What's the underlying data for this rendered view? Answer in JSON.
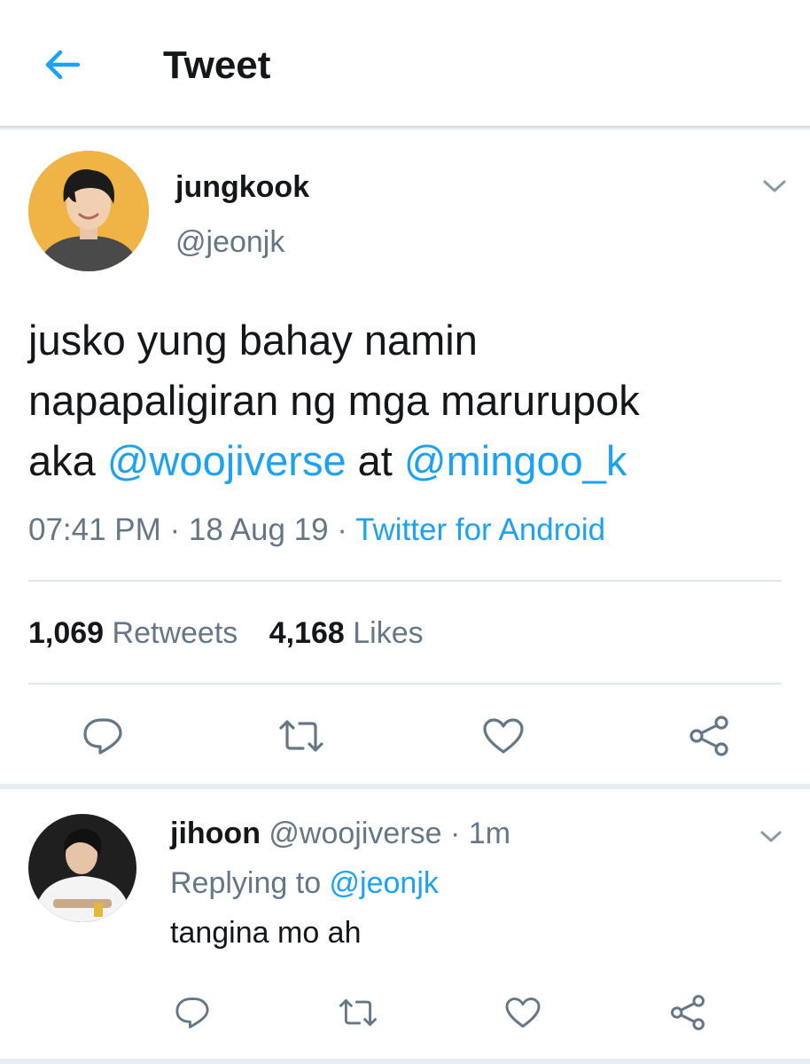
{
  "header": {
    "back_icon": "arrow-left-icon",
    "title": "Tweet",
    "accent_color": "#1da1f2"
  },
  "tweet": {
    "author_name": "jungkook",
    "author_handle": "@jeonjk",
    "menu_icon": "chevron-down-icon",
    "text_lines": [
      "jusko yung bahay namin",
      "napapaligiran ng mga marurupok"
    ],
    "text_prefix": "aka ",
    "mention_1": "@woojiverse",
    "text_middle": " at ",
    "mention_2": "@mingoo_k",
    "time": "07:41 PM",
    "sep_1": " · ",
    "date": "18 Aug 19",
    "sep_2": " · ",
    "source": "Twitter for Android",
    "retweets_count": "1,069",
    "retweets_label": " Retweets",
    "likes_count": "4,168",
    "likes_label": " Likes",
    "actions": [
      "reply-icon",
      "retweet-icon",
      "like-icon",
      "share-icon"
    ]
  },
  "reply": {
    "name": "jihoon",
    "handle": " @woojiverse",
    "sep": " · ",
    "time": "1m",
    "replying_prefix": "Replying to ",
    "replying_to": "@jeonjk",
    "text": "tangina mo ah",
    "actions": [
      "reply-icon",
      "retweet-icon",
      "like-icon",
      "share-icon"
    ]
  }
}
